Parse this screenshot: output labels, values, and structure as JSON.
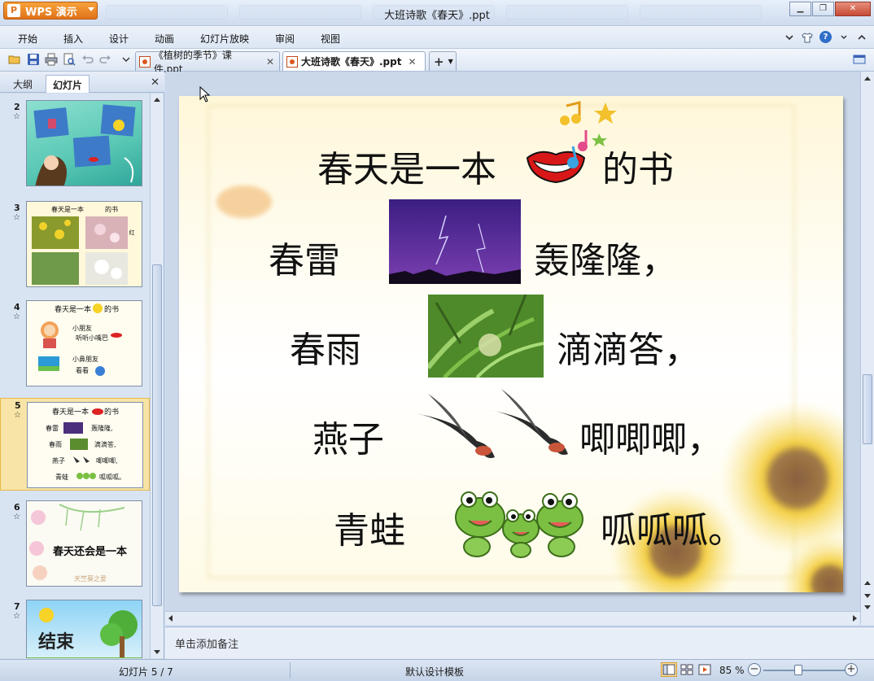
{
  "app": {
    "button_label": "WPS 演示",
    "window_title": "大班诗歌《春天》.ppt"
  },
  "menu": [
    "开始",
    "插入",
    "设计",
    "动画",
    "幻灯片放映",
    "审阅",
    "视图"
  ],
  "tabs": [
    {
      "label": "《植树的季节》课件.ppt",
      "active": false
    },
    {
      "label": "大班诗歌《春天》.ppt",
      "active": true
    }
  ],
  "panel": {
    "tabs": [
      "大纲",
      "幻灯片"
    ],
    "slides": [
      {
        "num": "2"
      },
      {
        "num": "3"
      },
      {
        "num": "4"
      },
      {
        "num": "5",
        "selected": true
      },
      {
        "num": "6"
      },
      {
        "num": "7"
      }
    ]
  },
  "slide": {
    "title_before": "春天是一本",
    "title_after": "的书",
    "rows": [
      {
        "label": "春雷",
        "sound": "轰隆隆，"
      },
      {
        "label": "春雨",
        "sound": "滴滴答，"
      },
      {
        "label": "燕子",
        "sound": "唧唧唧，"
      },
      {
        "label": "青蛙",
        "sound": "呱呱呱。"
      }
    ]
  },
  "notes": {
    "placeholder": "单击添加备注"
  },
  "status": {
    "slide_counter": "幻灯片 5 / 7",
    "template": "默认设计模板",
    "zoom": "85 %",
    "zoom_fraction": 0.85
  },
  "colors": {
    "app_button": "#e0731a",
    "selection": "#f8e4a6",
    "chrome": "#d3e0f1"
  }
}
